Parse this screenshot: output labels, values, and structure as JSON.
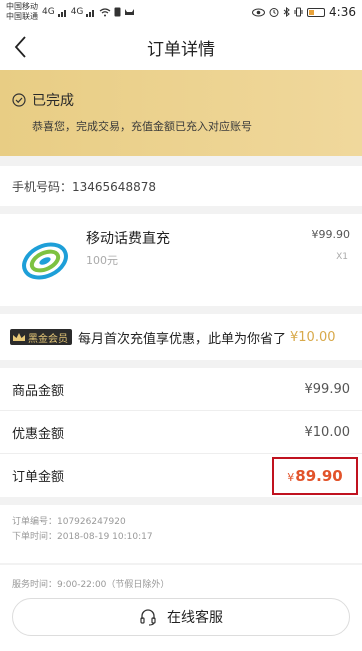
{
  "statusbar": {
    "carrier1": "中国移动",
    "carrier2": "中国联通",
    "sig1": "4G",
    "sig2": "4G",
    "time": "4:36"
  },
  "nav": {
    "title": "订单详情"
  },
  "banner": {
    "status": "已完成",
    "message": "恭喜您，完成交易，充值金额已充入对应账号"
  },
  "phone": {
    "label": "手机号码：13465648878"
  },
  "product": {
    "name": "移动话费直充",
    "face_value": "100元",
    "price": "¥99.90",
    "quantity": "X1"
  },
  "member": {
    "badge": "黑金会员",
    "text": "每月首次充值享优惠，此单为你省了",
    "saved": "¥10.00"
  },
  "summary": {
    "goods_label": "商品金额",
    "goods_value": "¥99.90",
    "discount_label": "优惠金额",
    "discount_value": "¥10.00",
    "total_label": "订单金额",
    "total_currency": "¥",
    "total_value": "89.90"
  },
  "meta": {
    "order_no": "订单编号：107926247920",
    "order_time": "下单时间：2018-08-19 10:10:17"
  },
  "footer": {
    "service_time": "服务时间：9:00-22:00（节假日除外）",
    "cs_label": "在线客服"
  },
  "colors": {
    "banner": "#e8cd84",
    "accent_gold": "#d8a94a",
    "total_red": "#e2532a",
    "highlight_box": "#c0121f"
  }
}
